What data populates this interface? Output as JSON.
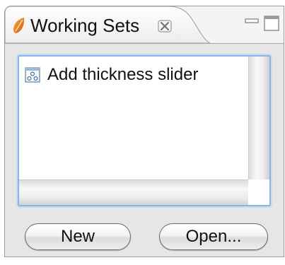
{
  "view": {
    "title": "Working Sets",
    "icons": {
      "view_icon": "orange-leaf-icon",
      "close": "close-x-icon",
      "minimize": "minimize-icon",
      "maximize": "maximize-icon"
    }
  },
  "list": {
    "items": [
      {
        "label": "Add thickness slider",
        "icon": "working-set-icon"
      }
    ]
  },
  "buttons": {
    "new_label": "New",
    "open_label": "Open..."
  },
  "colors": {
    "accent_focus": "#8fb3e0",
    "tab_icon": "#e8781e"
  }
}
